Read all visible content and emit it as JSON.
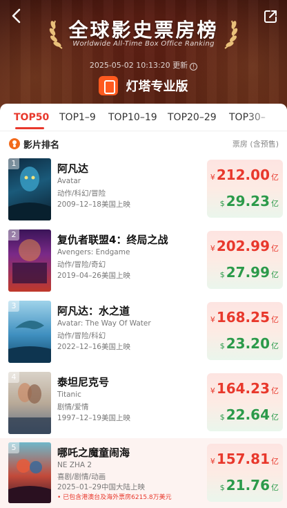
{
  "header": {
    "title": "全球影史票房榜",
    "subtitle": "Worldwide All-Time Box Office Ranking",
    "update_time": "2025-05-02 10:13:20 更新",
    "info_glyph": "!",
    "brand_name": "灯塔专业版"
  },
  "tabs": [
    "TOP50",
    "TOP1–9",
    "TOP10–19",
    "TOP20–29",
    "TOP30–"
  ],
  "active_tab": "TOP50",
  "list_header": {
    "label": "影片排名",
    "box_office_label": "票房 (含预售)"
  },
  "currency": {
    "rmb_symbol": "¥",
    "usd_symbol": "$",
    "unit": "亿"
  },
  "movies": [
    {
      "rank": "1",
      "title": "阿凡达",
      "english_title": "Avatar",
      "genre": "动作/科幻/冒险",
      "release": "2009–12–18美国上映",
      "rmb": "212.00",
      "usd": "29.23",
      "note": ""
    },
    {
      "rank": "2",
      "title": "复仇者联盟4：终局之战",
      "english_title": "Avengers: Endgame",
      "genre": "动作/冒险/奇幻",
      "release": "2019–04–26美国上映",
      "rmb": "202.99",
      "usd": "27.99",
      "note": ""
    },
    {
      "rank": "3",
      "title": "阿凡达：水之道",
      "english_title": "Avatar: The Way Of Water",
      "genre": "动作/冒险/科幻",
      "release": "2022–12–16美国上映",
      "rmb": "168.25",
      "usd": "23.20",
      "note": ""
    },
    {
      "rank": "4",
      "title": "泰坦尼克号",
      "english_title": "Titanic",
      "genre": "剧情/爱情",
      "release": "1997–12–19美国上映",
      "rmb": "164.23",
      "usd": "22.64",
      "note": ""
    },
    {
      "rank": "5",
      "title": "哪吒之魔童闹海",
      "english_title": "NE ZHA 2",
      "genre": "喜剧/剧情/动画",
      "release": "2025–01–29中国大陆上映",
      "rmb": "157.81",
      "usd": "21.76",
      "note": "• 已包含港澳台及海外票房6215.8万美元"
    }
  ],
  "colors": {
    "accent_red": "#e8382c",
    "usd_green": "#2b9a4a",
    "brand_orange": "#ff5a1f"
  },
  "icons": {
    "back": "chevron-left-icon",
    "share": "share-icon",
    "list_header": "film-icon"
  }
}
